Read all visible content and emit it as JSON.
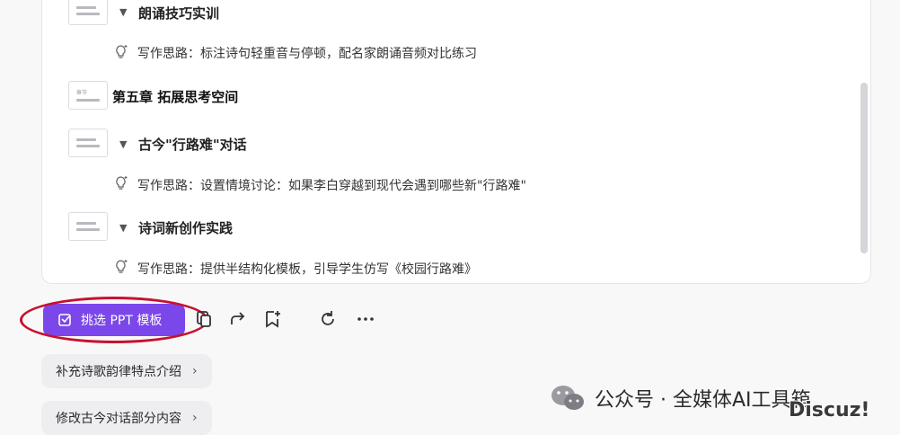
{
  "outline": {
    "sections": [
      {
        "title": "朗诵技巧实训",
        "note": "写作思路：标注诗句轻重音与停顿，配名家朗诵音频对比练习"
      },
      {
        "chapter": "第五章 拓展思考空间"
      },
      {
        "title": "古今\"行路难\"对话",
        "note": "写作思路：设置情境讨论：如果李白穿越到现代会遇到哪些新\"行路难\""
      },
      {
        "title": "诗词新创作实践",
        "note": "写作思路：提供半结构化模板，引导学生仿写《校园行路难》"
      }
    ]
  },
  "toolbar": {
    "ppt_button_label": "挑选 PPT 模板"
  },
  "suggestions": [
    {
      "label": "补充诗歌韵律特点介绍"
    },
    {
      "label": "修改古今对话部分内容"
    }
  ],
  "watermark": {
    "text": "公众号 · 全媒体AI工具箱",
    "discuz": "Discuz!"
  },
  "colors": {
    "accent": "#7b47ea",
    "highlight_ring": "#c8102e"
  }
}
